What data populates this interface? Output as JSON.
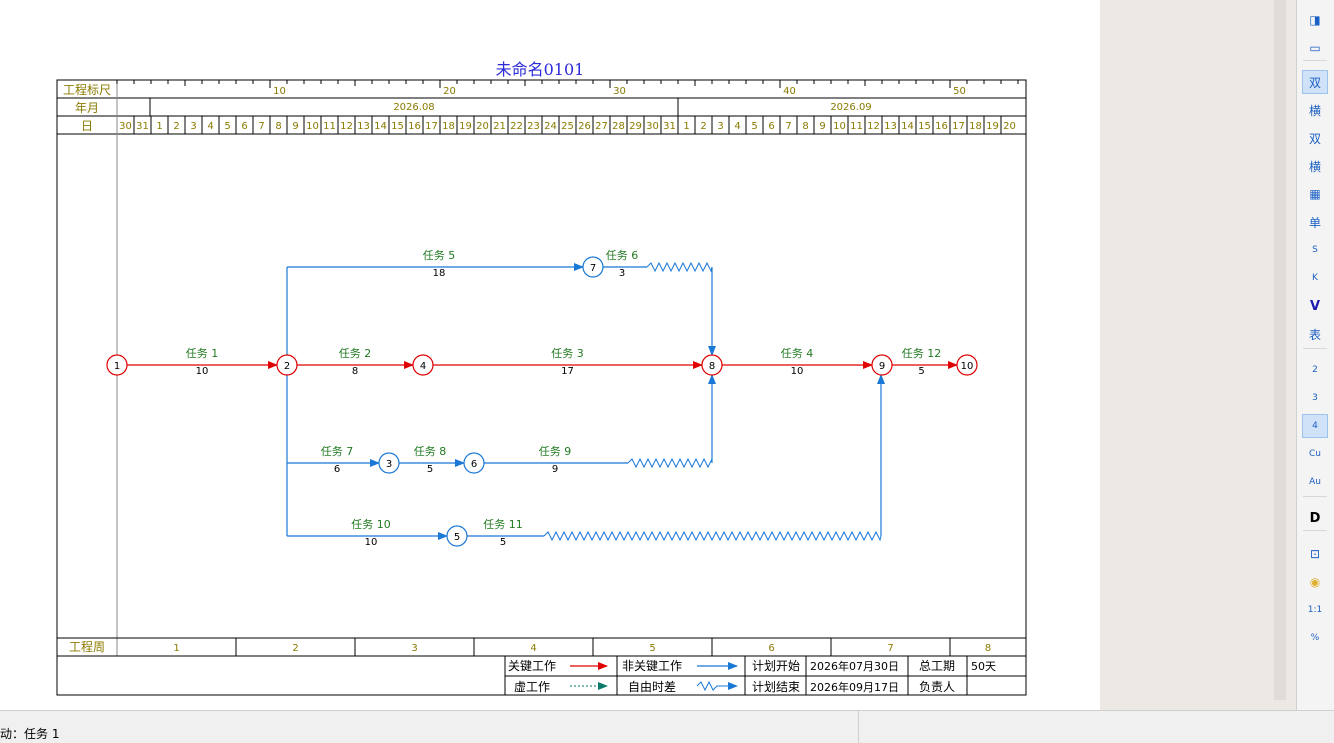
{
  "title": "未命名0101",
  "header": {
    "scale_label": "工程标尺",
    "yearmonth_label": "年月",
    "day_label": "日",
    "week_label": "工程周",
    "scale_marks": [
      "10",
      "20",
      "30",
      "40",
      "50"
    ],
    "months": [
      "2026.08",
      "2026.09"
    ],
    "days": [
      "30",
      "31",
      "1",
      "2",
      "3",
      "4",
      "5",
      "6",
      "7",
      "8",
      "9",
      "10",
      "11",
      "12",
      "13",
      "14",
      "15",
      "16",
      "17",
      "18",
      "19",
      "20",
      "21",
      "22",
      "23",
      "24",
      "25",
      "26",
      "27",
      "28",
      "29",
      "30",
      "31",
      "1",
      "2",
      "3",
      "4",
      "5",
      "6",
      "7",
      "8",
      "9",
      "10",
      "11",
      "12",
      "13",
      "14",
      "15",
      "16",
      "17",
      "18",
      "19",
      "20"
    ],
    "weeks": [
      "1",
      "2",
      "3",
      "4",
      "5",
      "6",
      "7",
      "8"
    ]
  },
  "network": {
    "nodes": [
      {
        "id": "1",
        "day": 0,
        "row": "r2",
        "critical": true
      },
      {
        "id": "2",
        "day": 10,
        "row": "r2",
        "critical": true
      },
      {
        "id": "4",
        "day": 18,
        "row": "r2",
        "critical": true
      },
      {
        "id": "8",
        "day": 35,
        "row": "r2",
        "critical": true
      },
      {
        "id": "9",
        "day": 45,
        "row": "r2",
        "critical": true
      },
      {
        "id": "10",
        "day": 50,
        "row": "r2",
        "critical": true
      },
      {
        "id": "7",
        "day": 28,
        "row": "r1",
        "critical": false
      },
      {
        "id": "3",
        "day": 16,
        "row": "r3",
        "critical": false
      },
      {
        "id": "6",
        "day": 21,
        "row": "r3",
        "critical": false
      },
      {
        "id": "5",
        "day": 20,
        "row": "r4",
        "critical": false
      }
    ],
    "tasks": [
      {
        "name": "任务 1",
        "duration": "10",
        "critical": true
      },
      {
        "name": "任务 2",
        "duration": "8",
        "critical": true
      },
      {
        "name": "任务 3",
        "duration": "17",
        "critical": true
      },
      {
        "name": "任务 4",
        "duration": "10",
        "critical": true
      },
      {
        "name": "任务 12",
        "duration": "5",
        "critical": true
      },
      {
        "name": "任务 5",
        "duration": "18",
        "critical": false
      },
      {
        "name": "任务 6",
        "duration": "3",
        "critical": false
      },
      {
        "name": "任务 7",
        "duration": "6",
        "critical": false
      },
      {
        "name": "任务 8",
        "duration": "5",
        "critical": false
      },
      {
        "name": "任务 9",
        "duration": "9",
        "critical": false
      },
      {
        "name": "任务 10",
        "duration": "10",
        "critical": false
      },
      {
        "name": "任务 11",
        "duration": "5",
        "critical": false
      }
    ]
  },
  "legend": {
    "critical": "关键工作",
    "noncritical": "非关键工作",
    "dummy": "虚工作",
    "float": "自由时差",
    "plan_start_label": "计划开始",
    "plan_start": "2026年07月30日",
    "plan_end_label": "计划结束",
    "plan_end": "2026年09月17日",
    "duration_label": "总工期",
    "duration": "50天",
    "owner_label": "负责人",
    "owner": ""
  },
  "toolbar": {
    "buttons": [
      {
        "icon": "panel-toggle-icon",
        "label": ""
      },
      {
        "icon": "panel-bottom-icon",
        "label": ""
      },
      {
        "icon": "double-code-icon",
        "label": "双",
        "active": true
      },
      {
        "icon": "horizontal-icon",
        "label": "横"
      },
      {
        "icon": "double-code-add-icon",
        "label": "双"
      },
      {
        "icon": "horizontal-add-icon",
        "label": "横"
      },
      {
        "icon": "table-icon",
        "label": ""
      },
      {
        "icon": "single-code-icon",
        "label": "单"
      },
      {
        "icon": "s-icon",
        "label": "S"
      },
      {
        "icon": "k-icon",
        "label": "K"
      },
      {
        "icon": "v-icon",
        "label": "V"
      },
      {
        "icon": "table-text-icon",
        "label": "表"
      },
      {
        "icon": "level-2-icon",
        "label": "2"
      },
      {
        "icon": "level-3-icon",
        "label": "3"
      },
      {
        "icon": "level-4-icon",
        "label": "4",
        "active": true
      },
      {
        "icon": "cu-icon",
        "label": "Cu"
      },
      {
        "icon": "au-icon",
        "label": "Au"
      },
      {
        "icon": "d-icon",
        "label": "D"
      },
      {
        "icon": "zoom-fit-icon",
        "label": ""
      },
      {
        "icon": "comment-icon",
        "label": ""
      },
      {
        "icon": "ratio-icon",
        "label": "1:1"
      },
      {
        "icon": "percent-icon",
        "label": "%"
      }
    ]
  },
  "status": {
    "text": "动：任务 1"
  },
  "colors": {
    "critical": "#e00000",
    "noncritical": "#1a78d6",
    "label_green": "#227a22",
    "header_text": "#8a7a00",
    "title": "#2b2bd9",
    "annotation_arrow": "#22dd00"
  }
}
